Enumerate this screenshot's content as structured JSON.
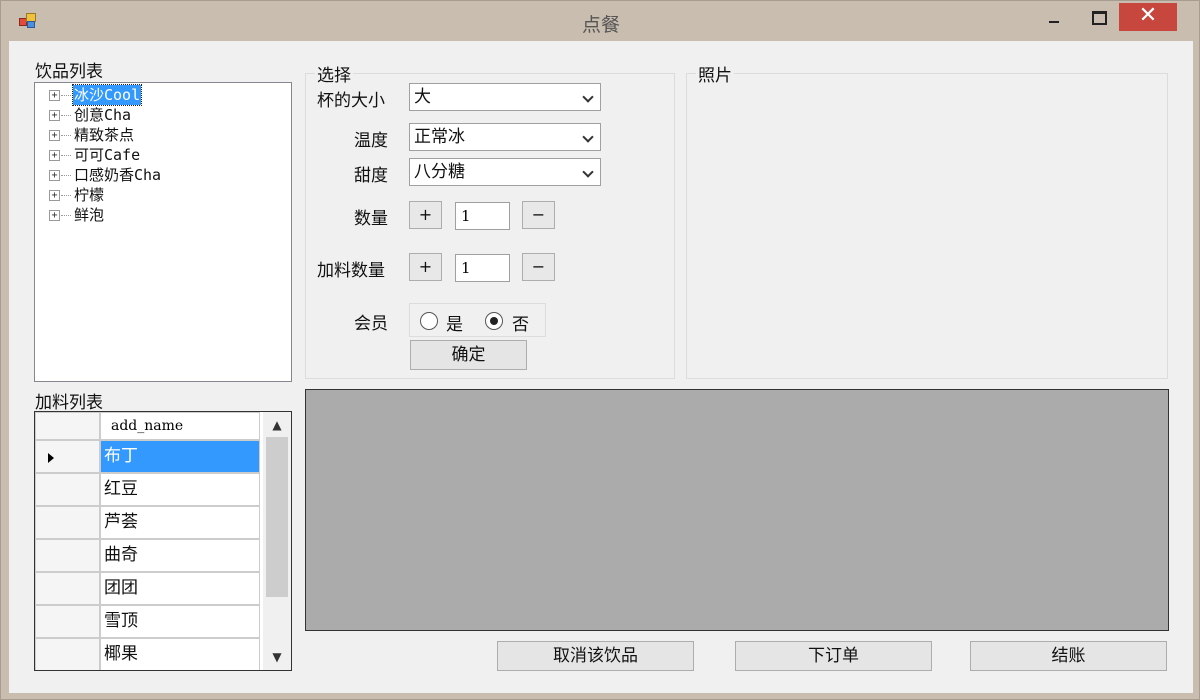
{
  "window": {
    "title": "点餐",
    "close_glyph": "✕"
  },
  "drinks": {
    "label": "饮品列表",
    "items": [
      "冰沙Cool",
      "创意Cha",
      "精致茶点",
      "可可Cafe",
      "口感奶香Cha",
      "柠檬",
      "鲜泡"
    ],
    "expand_glyph": "+"
  },
  "addons": {
    "label": "加料列表",
    "column": "add_name",
    "rows": [
      "布丁",
      "红豆",
      "芦荟",
      "曲奇",
      "团团",
      "雪顶",
      "椰果"
    ]
  },
  "select": {
    "title": "选择",
    "size_label": "杯的大小",
    "size_value": "大",
    "temp_label": "温度",
    "temp_value": "正常冰",
    "sweet_label": "甜度",
    "sweet_value": "八分糖",
    "qty_label": "数量",
    "qty_value": "1",
    "addon_qty_label": "加料数量",
    "addon_qty_value": "1",
    "plus": "+",
    "minus": "−",
    "member_label": "会员",
    "member_yes": "是",
    "member_no": "否",
    "confirm": "确定"
  },
  "photo": {
    "title": "照片"
  },
  "actions": {
    "cancel_drink": "取消该饮品",
    "place_order": "下订单",
    "checkout": "结账"
  }
}
